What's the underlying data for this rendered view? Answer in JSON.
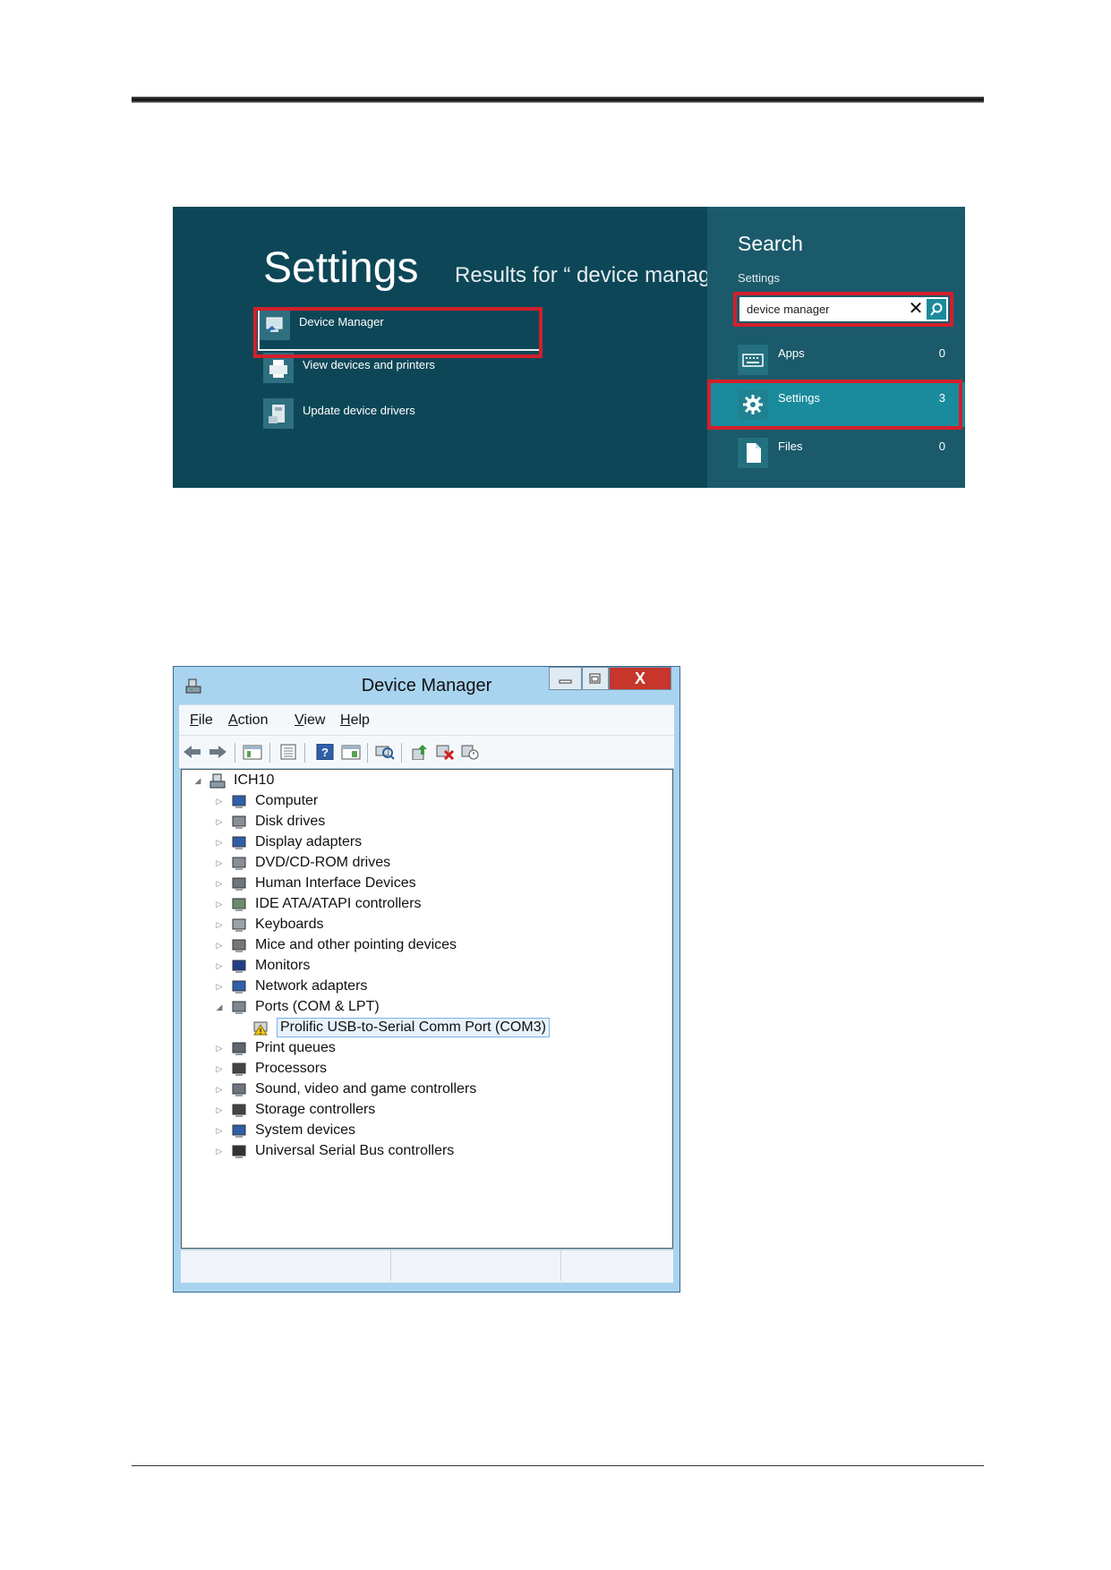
{
  "win8_search": {
    "title": "Settings",
    "results_label": "Results for “ device manager",
    "results": [
      {
        "label": "Device Manager",
        "icon": "device-manager-icon"
      },
      {
        "label": "View devices and printers",
        "icon": "printer-icon"
      },
      {
        "label": "Update device drivers",
        "icon": "driver-update-icon"
      }
    ],
    "pane": {
      "title": "Search",
      "subtitle": "Settings",
      "query": "device manager",
      "clear_glyph": "✕",
      "categories": [
        {
          "label": "Apps",
          "count": "0",
          "icon": "keyboard-icon"
        },
        {
          "label": "Settings",
          "count": "3",
          "icon": "gear-icon"
        },
        {
          "label": "Files",
          "count": "0",
          "icon": "file-icon"
        }
      ]
    },
    "colors": {
      "background": "#0d4757",
      "pane": "#1b5a6a",
      "accent": "#1a8b9c",
      "highlight": "#d31f2c"
    }
  },
  "device_manager": {
    "title": "Device Manager",
    "close_glyph": "X",
    "menu": [
      {
        "label": "File",
        "u": "F",
        "rest": "ile"
      },
      {
        "label": "Action",
        "u": "A",
        "rest": "ction"
      },
      {
        "label": "View",
        "u": "V",
        "rest": "iew"
      },
      {
        "label": "Help",
        "u": "H",
        "rest": "elp"
      }
    ],
    "toolbar": [
      "back-icon",
      "forward-icon",
      "show-hide-console-tree-icon",
      "properties-icon",
      "help-icon",
      "show-action-pane-icon",
      "scan-hardware-icon",
      "update-driver-icon",
      "uninstall-icon",
      "disable-device-icon"
    ],
    "tree": {
      "root": "ICH10",
      "categories": [
        "Computer",
        "Disk drives",
        "Display adapters",
        "DVD/CD-ROM drives",
        "Human Interface Devices",
        "IDE ATA/ATAPI controllers",
        "Keyboards",
        "Mice and other pointing devices",
        "Monitors",
        "Network adapters",
        "Ports (COM & LPT)",
        "Print queues",
        "Processors",
        "Sound, video and game controllers",
        "Storage controllers",
        "System devices",
        "Universal Serial Bus controllers"
      ],
      "expanded_child": "Prolific USB-to-Serial Comm Port (COM3)",
      "expanded_child_status": "warning",
      "collapsed_glyph": "▷",
      "expanded_glyph": "◢"
    }
  }
}
